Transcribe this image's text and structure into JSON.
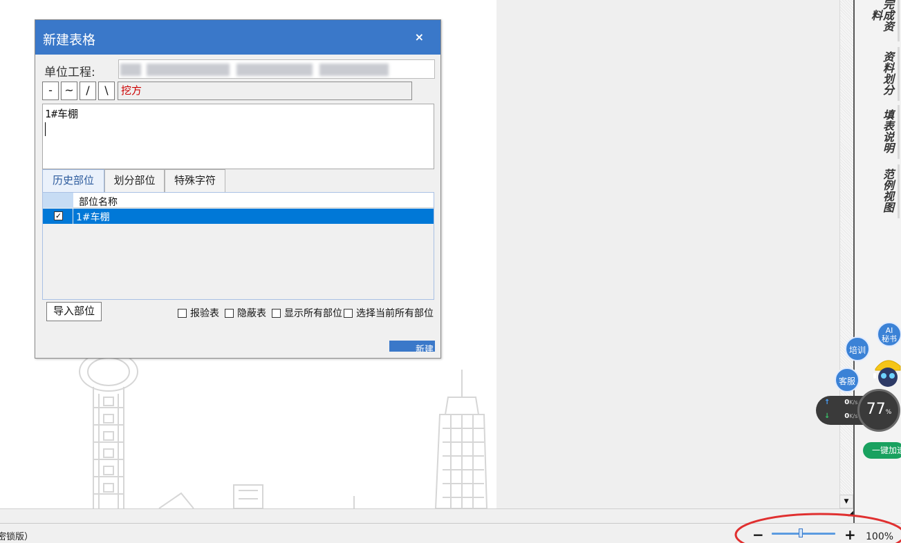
{
  "dialog": {
    "title": "新建表格",
    "close_symbol": "×",
    "unit_label": "单位工程:",
    "unit_value": "",
    "symbols": [
      "-",
      "~",
      "/",
      "\\"
    ],
    "text_field_value": "挖方",
    "textarea_value": "1#车棚",
    "tabs": [
      "历史部位",
      "划分部位",
      "特殊字符"
    ],
    "grid": {
      "column_header": "部位名称",
      "rows": [
        {
          "checked": true,
          "name": "1#车棚"
        }
      ]
    },
    "import_button": "导入部位",
    "checkboxes": [
      "报验表",
      "隐蔽表",
      "显示所有部位",
      "选择当前所有部位"
    ],
    "new_button": "新建"
  },
  "side_tabs": [
    "完成资料",
    "资料划分",
    "填表说明",
    "范例视图"
  ],
  "widgets": {
    "ai_label_1": "AI",
    "ai_label_2": "秘书",
    "training": "培训",
    "service": "客服",
    "upload_speed": "0",
    "download_speed": "0",
    "speed_unit": "K/s",
    "gauge_value": "77",
    "gauge_unit": "%",
    "boost_label": "一键加速"
  },
  "status": {
    "edition_text": "密锁版）"
  },
  "zoom": {
    "minus": "−",
    "plus": "+",
    "value": "100%",
    "level_percent": 100
  },
  "colors": {
    "title_bar": "#3a78c9",
    "selection": "#0078d7",
    "annotation": "#e03030",
    "boost": "#19a15f"
  }
}
